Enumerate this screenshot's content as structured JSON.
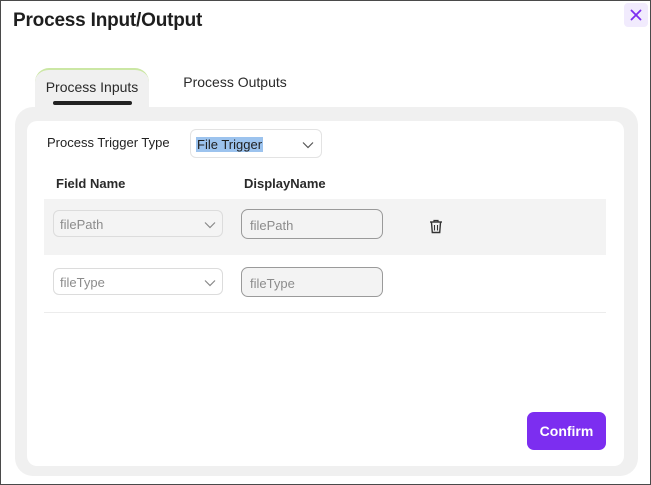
{
  "dialog": {
    "title": "Process Input/Output",
    "close_icon": "close-icon"
  },
  "tabs": [
    {
      "label": "Process Inputs",
      "active": true
    },
    {
      "label": "Process Outputs",
      "active": false
    }
  ],
  "trigger": {
    "label": "Process Trigger Type",
    "value": "File Trigger"
  },
  "table": {
    "columns": [
      "Field Name",
      "DisplayName"
    ],
    "rows": [
      {
        "field": "filePath",
        "display": "filePath",
        "has_delete": true
      },
      {
        "field": "fileType",
        "display": "fileType",
        "has_delete": false
      }
    ]
  },
  "actions": {
    "confirm_label": "Confirm"
  },
  "colors": {
    "accent": "#7c2ef0",
    "close_bg": "#f1ebfd",
    "selection_highlight": "#9cc3ee",
    "tab_border": "#cbe7a4"
  }
}
